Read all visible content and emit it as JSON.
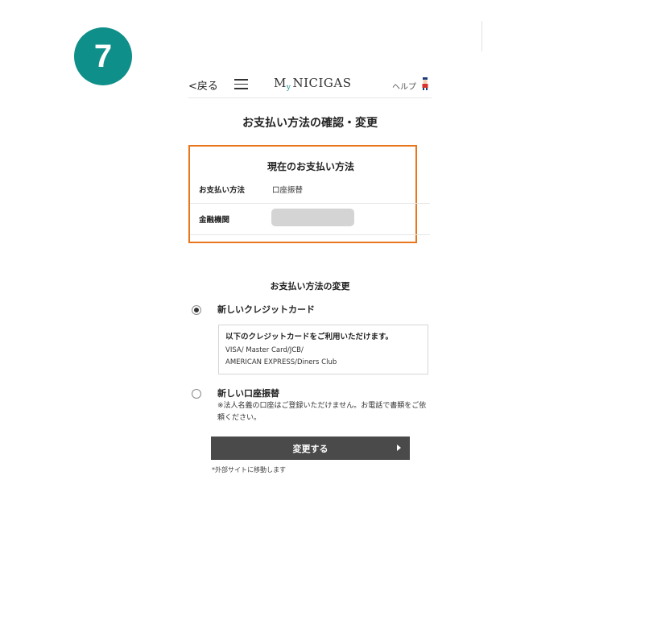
{
  "step": {
    "number": "7",
    "color": "#0f8f8a"
  },
  "header": {
    "back_label": "<戻る",
    "menu_icon": "hamburger-menu-icon",
    "logo_m": "M",
    "logo_y": "y",
    "logo_rest": "NICIGAS",
    "help_label": "ヘルプ",
    "help_icon": "character-mascot-icon"
  },
  "page_title": "お支払い方法の確認・変更",
  "current": {
    "title": "現在のお支払い方法",
    "method_label": "お支払い方法",
    "method_value": "口座振替",
    "bank_label": "金融機関",
    "highlight_color": "#e8761c"
  },
  "change": {
    "title": "お支払い方法の変更",
    "options": [
      {
        "label": "新しいクレジットカード",
        "selected": true,
        "info_title": "以下のクレジットカードをご利用いただけます。",
        "info_line1": "VISA/ Master Card/JCB/",
        "info_line2": "AMERICAN EXPRESS/Diners Club"
      },
      {
        "label": "新しい口座振替",
        "selected": false,
        "note": "※法人名義の口座はご登録いただけません。お電話で書類をご依頼ください。"
      }
    ],
    "submit_label": "変更する",
    "external_note": "*外部サイトに移動します"
  }
}
